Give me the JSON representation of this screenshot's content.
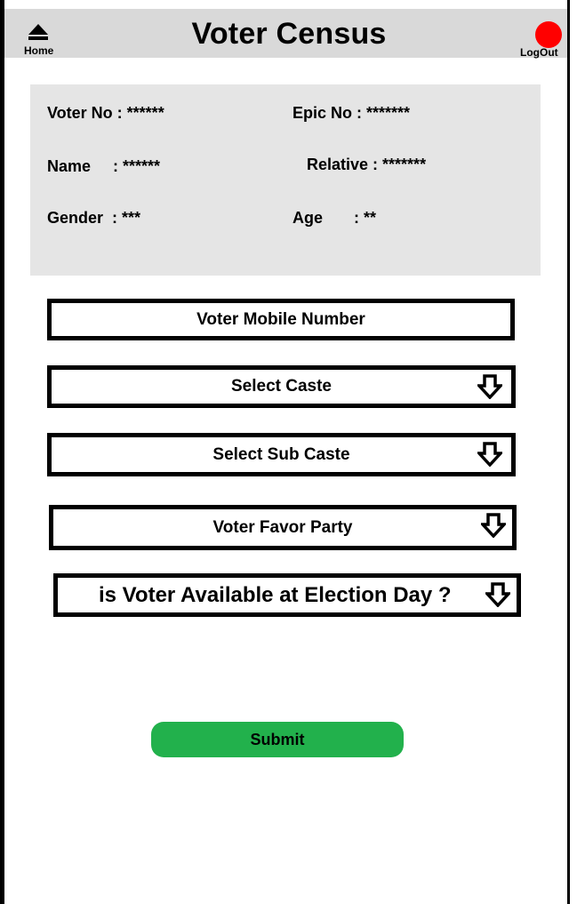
{
  "header": {
    "title": "Voter Census",
    "home_label": "Home",
    "home_icon": "home-up-triangle-icon",
    "logout_label": "LogOut",
    "logout_icon": "red-dot-icon"
  },
  "voter_info": {
    "voter_no": "Voter No : ******",
    "epic_no": "Epic No : *******",
    "name": "Name     : ******",
    "relative": "Relative : *******",
    "gender": "Gender  : ***",
    "age": "Age       : **"
  },
  "form": {
    "mobile_number_label": "Voter Mobile Number",
    "caste_label": "Select Caste",
    "sub_caste_label": "Select Sub Caste",
    "favor_party_label": "Voter Favor Party",
    "availability_label": "is Voter Available at Election Day ?"
  },
  "actions": {
    "submit_label": "Submit"
  },
  "colors": {
    "header_bg": "#d9d9d9",
    "card_bg": "#e5e5e5",
    "logout_dot": "#ff0000",
    "submit_bg": "#22b14c"
  }
}
